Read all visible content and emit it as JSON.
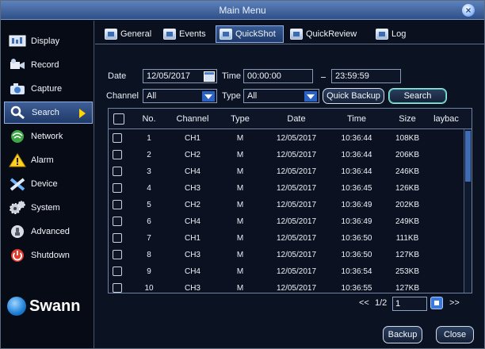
{
  "window": {
    "title": "Main Menu"
  },
  "sidebar": {
    "items": [
      {
        "label": "Display",
        "icon": "display-icon",
        "active": false
      },
      {
        "label": "Record",
        "icon": "record-icon",
        "active": false
      },
      {
        "label": "Capture",
        "icon": "capture-icon",
        "active": false
      },
      {
        "label": "Search",
        "icon": "search-icon",
        "active": true
      },
      {
        "label": "Network",
        "icon": "network-icon",
        "active": false
      },
      {
        "label": "Alarm",
        "icon": "alarm-icon",
        "active": false
      },
      {
        "label": "Device",
        "icon": "device-icon",
        "active": false
      },
      {
        "label": "System",
        "icon": "system-icon",
        "active": false
      },
      {
        "label": "Advanced",
        "icon": "advanced-icon",
        "active": false
      },
      {
        "label": "Shutdown",
        "icon": "shutdown-icon",
        "active": false
      }
    ],
    "brand": "Swann"
  },
  "tabs": [
    {
      "label": "General",
      "active": false
    },
    {
      "label": "Events",
      "active": false
    },
    {
      "label": "QuickShot",
      "active": true
    },
    {
      "label": "QuickReview",
      "active": false
    },
    {
      "label": "Log",
      "active": false
    }
  ],
  "filters": {
    "date_label": "Date",
    "date_value": "12/05/2017",
    "time_label": "Time",
    "time_start": "00:00:00",
    "time_sep": "-",
    "time_end": "23:59:59",
    "channel_label": "Channel",
    "channel_value": "All",
    "type_label": "Type",
    "type_value": "All",
    "quick_backup": "Quick Backup",
    "search": "Search"
  },
  "table": {
    "headers": [
      "No.",
      "Channel",
      "Type",
      "Date",
      "Time",
      "Size",
      "laybac"
    ],
    "rows": [
      [
        "1",
        "CH1",
        "M",
        "12/05/2017",
        "10:36:44",
        "108KB"
      ],
      [
        "2",
        "CH2",
        "M",
        "12/05/2017",
        "10:36:44",
        "206KB"
      ],
      [
        "3",
        "CH4",
        "M",
        "12/05/2017",
        "10:36:44",
        "246KB"
      ],
      [
        "4",
        "CH3",
        "M",
        "12/05/2017",
        "10:36:45",
        "126KB"
      ],
      [
        "5",
        "CH2",
        "M",
        "12/05/2017",
        "10:36:49",
        "202KB"
      ],
      [
        "6",
        "CH4",
        "M",
        "12/05/2017",
        "10:36:49",
        "249KB"
      ],
      [
        "7",
        "CH1",
        "M",
        "12/05/2017",
        "10:36:50",
        "111KB"
      ],
      [
        "8",
        "CH3",
        "M",
        "12/05/2017",
        "10:36:50",
        "127KB"
      ],
      [
        "9",
        "CH4",
        "M",
        "12/05/2017",
        "10:36:54",
        "253KB"
      ],
      [
        "10",
        "CH3",
        "M",
        "12/05/2017",
        "10:36:55",
        "127KB"
      ]
    ]
  },
  "pager": {
    "prev": "<<",
    "page_info": "1/2",
    "page_input": "1",
    "next": ">>"
  },
  "footer": {
    "backup": "Backup",
    "close": "Close"
  },
  "colors": {
    "accent": "#2f5fa8",
    "highlight": "#ffd600",
    "panel": "#0b1222"
  }
}
